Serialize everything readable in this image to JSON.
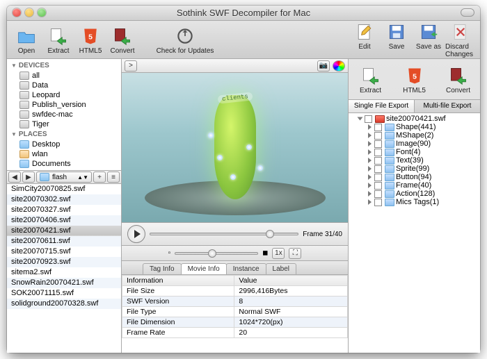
{
  "title": "Sothink SWF Decompiler for Mac",
  "toolbar": {
    "left": [
      {
        "label": "Open"
      },
      {
        "label": "Extract"
      },
      {
        "label": "HTML5"
      },
      {
        "label": "Convert"
      }
    ],
    "mid": [
      {
        "label": "Check for Updates"
      }
    ],
    "right": [
      {
        "label": "Edit"
      },
      {
        "label": "Save"
      },
      {
        "label": "Save as"
      },
      {
        "label": "Discard Changes"
      }
    ]
  },
  "sidebar": {
    "devices_hdr": "DEVICES",
    "devices": [
      "all",
      "Data",
      "Leopard",
      "Publish_version",
      "swfdec-mac",
      "Tiger"
    ],
    "places_hdr": "PLACES",
    "places": [
      "Desktop",
      "wlan",
      "Documents"
    ]
  },
  "pathbar": {
    "folder": "flash"
  },
  "files": [
    "SimCity20070825.swf",
    "site20070302.swf",
    "site20070327.swf",
    "site20070406.swf",
    "site20070421.swf",
    "site20070611.swf",
    "site20070715.swf",
    "site20070923.swf",
    "sitema2.swf",
    "SnowRain20070421.swf",
    "SOK20071115.swf",
    "solidground20070328.swf"
  ],
  "preview": {
    "banner": "clients"
  },
  "playback": {
    "frame_label": "Frame 31/40",
    "zoom": "1x"
  },
  "info_tabs": [
    "Tag Info",
    "Movie Info",
    "Instance",
    "Label"
  ],
  "info_cols": [
    "Information",
    "Value"
  ],
  "info_rows": [
    [
      "File Size",
      "2996,416Bytes"
    ],
    [
      "SWF Version",
      "8"
    ],
    [
      "File Type",
      "Normal SWF"
    ],
    [
      "File Dimension",
      "1024*720(px)"
    ],
    [
      "Frame Rate",
      "20"
    ]
  ],
  "right_tools": [
    "Extract",
    "HTML5",
    "Convert"
  ],
  "right_tabs": [
    "Single File Export",
    "Multi-file Export"
  ],
  "tree_root": "site20070421.swf",
  "tree": [
    "Shape(441)",
    "MShape(2)",
    "Image(90)",
    "Font(4)",
    "Text(39)",
    "Sprite(99)",
    "Button(94)",
    "Frame(40)",
    "Action(128)",
    "Mics Tags(1)"
  ]
}
